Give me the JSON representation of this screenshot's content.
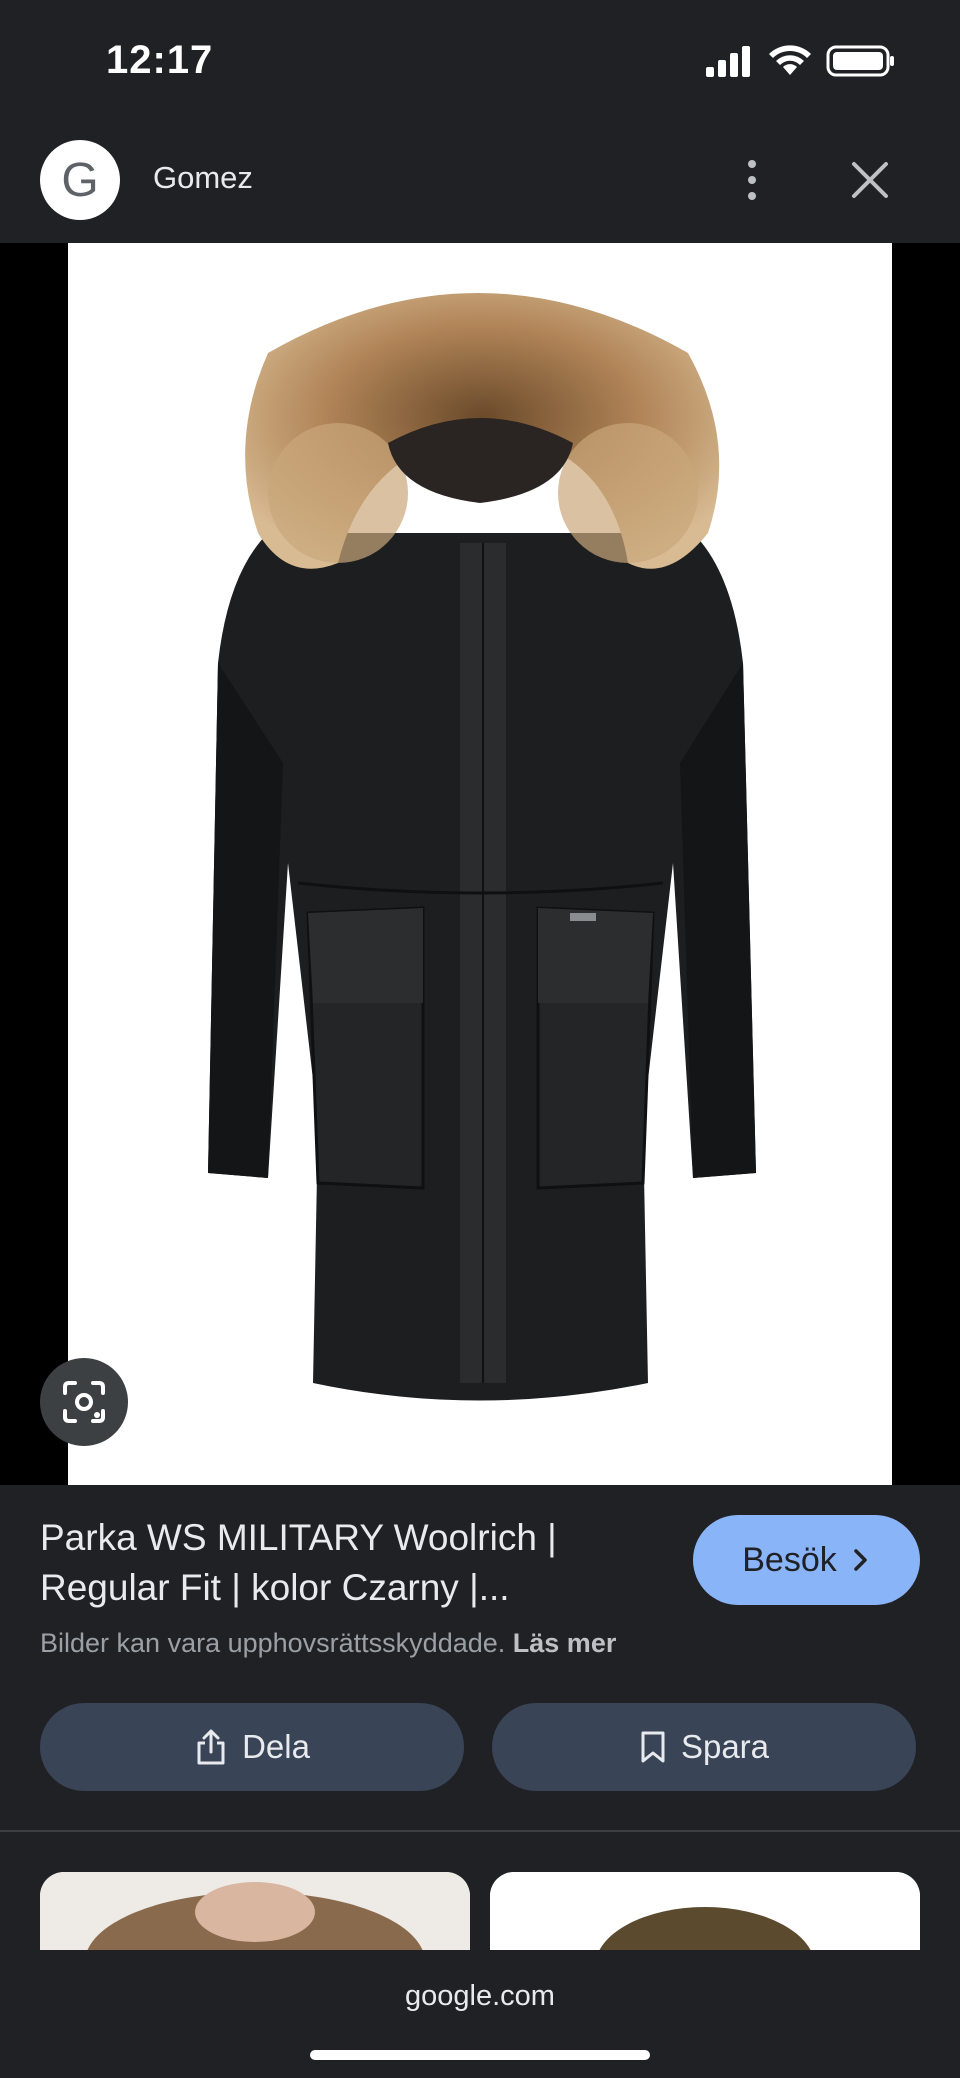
{
  "status_bar": {
    "time": "12:17"
  },
  "app_bar": {
    "logo_letter": "G",
    "title": "Gomez"
  },
  "result": {
    "title": "Parka WS MILITARY Woolrich | Regular Fit | kolor Czarny |...",
    "visit_label": "Besök",
    "copyright_text": "Bilder kan vara upphovsrättsskyddade.",
    "learn_more": "Läs mer",
    "share_label": "Dela",
    "save_label": "Spara"
  },
  "bottom": {
    "domain": "google.com"
  },
  "colors": {
    "background": "#202124",
    "accent": "#8ab4f8",
    "chip": "#394457"
  },
  "icons": [
    "google-g-icon",
    "more-vert-icon",
    "close-icon",
    "lens-icon",
    "chevron-right-icon",
    "share-icon",
    "bookmark-icon"
  ]
}
